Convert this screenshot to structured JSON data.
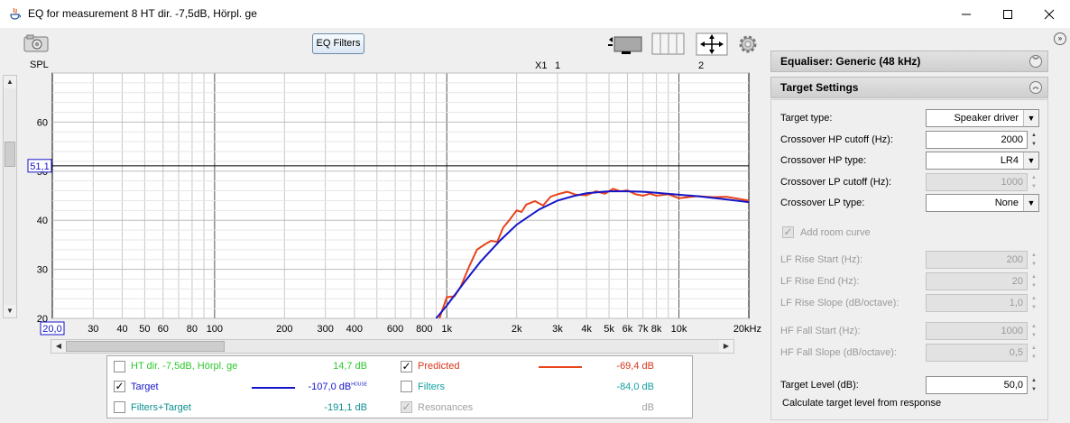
{
  "window": {
    "title": "EQ for measurement 8 HT dir. -7,5dB, Hörpl. ge",
    "minimize_icon": "minimize-icon",
    "maximize_icon": "maximize-icon",
    "close_icon": "close-icon"
  },
  "toolbar": {
    "eq_filters_label": "EQ Filters",
    "camera_icon": "camera-icon",
    "graph_layout_icon": "graph-layout-icon",
    "controls_icon": "controls-icon",
    "pan_icon": "pan-arrows-icon",
    "settings_icon": "gear-icon"
  },
  "chart_labels": {
    "spl": "SPL",
    "cursor_level": "51,1",
    "x_start": "20,0",
    "marker_x1": "X1",
    "marker_1": "1",
    "marker_2": "2"
  },
  "chart_data": {
    "type": "line",
    "xscale": "log",
    "xlim": [
      20,
      20000
    ],
    "ylim": [
      20,
      70
    ],
    "ylabel": "SPL",
    "y_ticks": [
      20,
      30,
      40,
      50,
      60
    ],
    "x_tick_labels": [
      {
        "x": 30,
        "label": "30"
      },
      {
        "x": 40,
        "label": "40"
      },
      {
        "x": 50,
        "label": "50"
      },
      {
        "x": 60,
        "label": "60"
      },
      {
        "x": 80,
        "label": "80"
      },
      {
        "x": 100,
        "label": "100"
      },
      {
        "x": 200,
        "label": "200"
      },
      {
        "x": 300,
        "label": "300"
      },
      {
        "x": 400,
        "label": "400"
      },
      {
        "x": 600,
        "label": "600"
      },
      {
        "x": 800,
        "label": "800"
      },
      {
        "x": 1000,
        "label": "1k"
      },
      {
        "x": 2000,
        "label": "2k"
      },
      {
        "x": 3000,
        "label": "3k"
      },
      {
        "x": 4000,
        "label": "4k"
      },
      {
        "x": 5000,
        "label": "5k"
      },
      {
        "x": 6000,
        "label": "6k"
      },
      {
        "x": 7000,
        "label": "7k"
      },
      {
        "x": 8000,
        "label": "8k"
      },
      {
        "x": 10000,
        "label": "10k"
      },
      {
        "x": 20000,
        "label": "20kHz"
      }
    ],
    "cursor_line_y": 51.1,
    "grid": true,
    "series": [
      {
        "name": "Target",
        "color": "#1515c8",
        "x": [
          900,
          1000,
          1200,
          1400,
          1700,
          2000,
          2500,
          3000,
          3500,
          4000,
          5000,
          6000,
          7000,
          8000,
          10000,
          12000,
          15000,
          20000
        ],
        "y": [
          20,
          22.6,
          27.6,
          31.6,
          35.9,
          39.1,
          42.2,
          44.0,
          44.9,
          45.5,
          45.9,
          45.9,
          45.8,
          45.6,
          45.2,
          44.9,
          44.4,
          43.7
        ]
      },
      {
        "name": "Predicted",
        "color": "#e8441a",
        "x": [
          930,
          1000,
          1080,
          1150,
          1250,
          1350,
          1450,
          1550,
          1650,
          1750,
          1850,
          2000,
          2100,
          2200,
          2400,
          2600,
          2800,
          3000,
          3300,
          3600,
          4000,
          4400,
          4800,
          5200,
          5600,
          6000,
          6500,
          7000,
          7500,
          8000,
          9000,
          10000,
          12000,
          14000,
          16000,
          20000
        ],
        "y": [
          20,
          24.3,
          24.5,
          26.5,
          30.6,
          34.0,
          35.0,
          35.8,
          35.6,
          38.5,
          39.9,
          42.0,
          41.7,
          43.2,
          43.9,
          43.0,
          44.8,
          45.3,
          45.8,
          45.2,
          45.1,
          45.9,
          45.4,
          46.4,
          45.9,
          46.1,
          45.3,
          45.0,
          45.4,
          45.0,
          45.3,
          44.5,
          44.9,
          44.7,
          44.8,
          44.0
        ]
      }
    ]
  },
  "legend": {
    "rows": [
      {
        "label": "HT dir. -7,5dB, Hörpl. ge",
        "checked": false,
        "value": "14,7 dB",
        "color": "#2ec82e"
      },
      {
        "label": "Predicted",
        "checked": true,
        "value": "-69,4 dB",
        "color": "#d8341a"
      },
      {
        "label": "Target",
        "checked": true,
        "value": "-107,0 dB",
        "value_sup": "HOUSE",
        "color": "#1515c8"
      },
      {
        "label": "Filters",
        "checked": false,
        "value": "-84,0 dB",
        "color": "#14a0a0"
      },
      {
        "label": "Filters+Target",
        "checked": false,
        "value": "-191,1 dB",
        "color": "#0e9090"
      },
      {
        "label": "Resonances",
        "checked": true,
        "value": "dB",
        "color": "#a0a0a0"
      }
    ]
  },
  "right_panel": {
    "expander_icon": "expand-panel-icon",
    "equaliser_header": "Equaliser: Generic (48 kHz)",
    "target_header": "Target Settings",
    "fields": {
      "target_type": {
        "label": "Target type:",
        "value": "Speaker driver"
      },
      "hp_cutoff": {
        "label": "Crossover HP cutoff (Hz):",
        "value": "2000"
      },
      "hp_type": {
        "label": "Crossover HP type:",
        "value": "LR4"
      },
      "lp_cutoff": {
        "label": "Crossover LP cutoff (Hz):",
        "value": "1000"
      },
      "lp_type": {
        "label": "Crossover LP type:",
        "value": "None"
      },
      "add_room_curve": {
        "label": "Add room curve",
        "checked": true
      },
      "lf_rise_start": {
        "label": "LF Rise Start (Hz):",
        "value": "200"
      },
      "lf_rise_end": {
        "label": "LF Rise End (Hz):",
        "value": "20"
      },
      "lf_rise_slope": {
        "label": "LF Rise Slope (dB/octave):",
        "value": "1,0"
      },
      "hf_fall_start": {
        "label": "HF Fall Start (Hz):",
        "value": "1000"
      },
      "hf_fall_slope": {
        "label": "HF Fall Slope (dB/octave):",
        "value": "0,5"
      },
      "target_level": {
        "label": "Target Level (dB):",
        "value": "50,0"
      },
      "calc_text": "Calculate target level from response"
    }
  }
}
